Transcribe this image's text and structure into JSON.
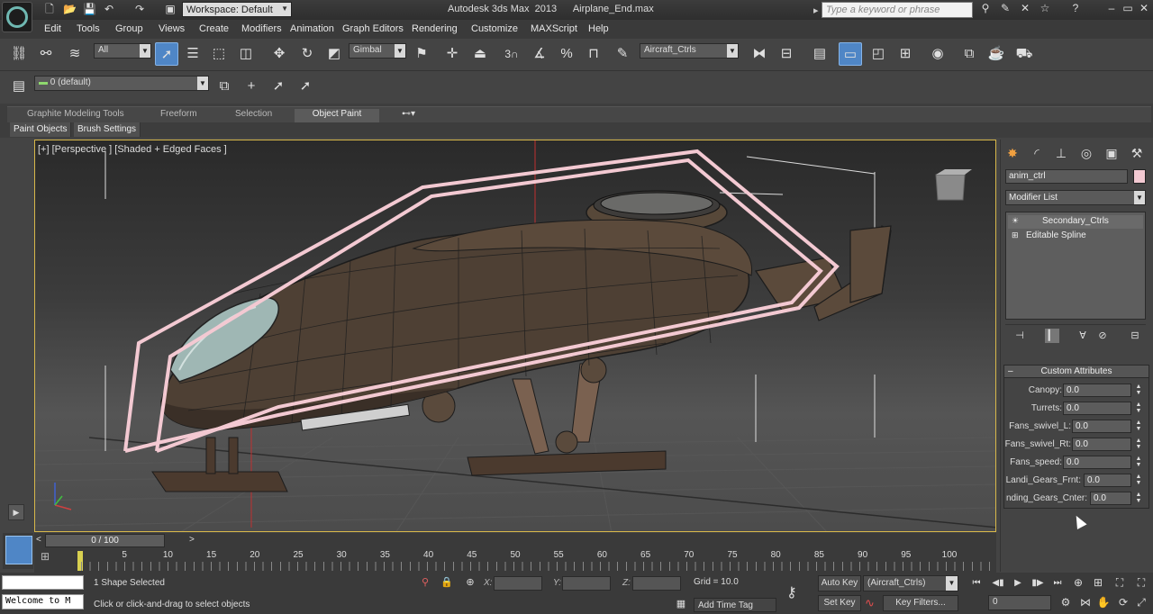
{
  "title_bar": {
    "workspace": "Workspace: Default",
    "app_name": "Autodesk 3ds Max  2013",
    "file_name": "Airplane_End.max",
    "search_placeholder": "Type a keyword or phrase"
  },
  "menu": [
    "Edit",
    "Tools",
    "Group",
    "Views",
    "Create",
    "Modifiers",
    "Animation",
    "Graph Editors",
    "Rendering",
    "Customize",
    "MAXScript",
    "Help"
  ],
  "toolbar": {
    "selection_filter": "All",
    "reference_coord": "Gimbal",
    "named_selection": "Aircraft_Ctrls",
    "snap_angle": "3",
    "layer": "0 (default)"
  },
  "ribbon": {
    "tabs": [
      "Graphite Modeling Tools",
      "Freeform",
      "Selection",
      "Object Paint"
    ],
    "active_tab": "Object Paint",
    "subtabs": [
      "Paint Objects",
      "Brush Settings"
    ]
  },
  "viewport": {
    "label": "[+] [Perspective ] [Shaded + Edged Faces ]"
  },
  "command_panel": {
    "object_name": "anim_ctrl",
    "object_color": "#f3c9d2",
    "modifier_list": "Modifier List",
    "stack": [
      "Secondary_Ctrls",
      "Editable Spline"
    ],
    "rollout_title": "Custom Attributes",
    "attributes": [
      {
        "label": "Canopy:",
        "value": "0.0"
      },
      {
        "label": "Turrets:",
        "value": "0.0"
      },
      {
        "label": "Fans_swivel_L:",
        "value": "0.0"
      },
      {
        "label": "Fans_swivel_Rt:",
        "value": "0.0"
      },
      {
        "label": "Fans_speed:",
        "value": "0.0"
      },
      {
        "label": "Landi_Gears_Frnt:",
        "value": "0.0"
      },
      {
        "label": "nding_Gears_Cnter:",
        "value": "0.0"
      }
    ]
  },
  "timeline": {
    "slider_label": "0 / 100",
    "ticks": [
      "5",
      "10",
      "15",
      "20",
      "25",
      "30",
      "35",
      "40",
      "45",
      "50",
      "55",
      "60",
      "65",
      "70",
      "75",
      "80",
      "85",
      "90",
      "95",
      "100"
    ]
  },
  "status": {
    "maxscript_text": "Welcome to M",
    "selection": "1 Shape Selected",
    "prompt": "Click or click-and-drag to select objects",
    "x_label": "X:",
    "y_label": "Y:",
    "z_label": "Z:",
    "grid": "Grid = 10.0",
    "add_time_tag": "Add Time Tag",
    "auto_key": "Auto Key",
    "set_key": "Set Key",
    "selection_set": "(Aircraft_Ctrls)",
    "key_filters": "Key Filters...",
    "current_frame": "0"
  },
  "colors": {
    "accent": "#4f86c6",
    "viewport_border": "#d8b84a",
    "control_cage": "#f3c9d2",
    "time_cursor": "#d8d050"
  }
}
